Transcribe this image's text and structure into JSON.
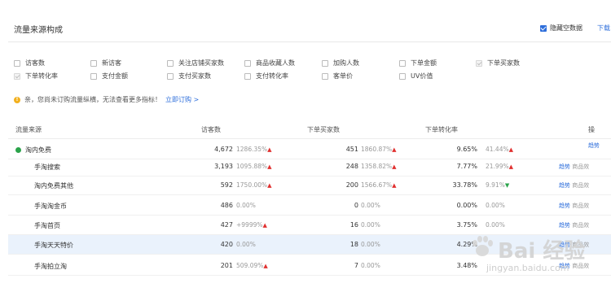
{
  "panel": {
    "title": "流量来源构成",
    "hide_empty_label": "隐藏空数据",
    "download_label": "下载"
  },
  "metrics": [
    {
      "label": "访客数",
      "state": "disabled"
    },
    {
      "label": "新访客",
      "state": "unchecked"
    },
    {
      "label": "关注店铺买家数",
      "state": "unchecked"
    },
    {
      "label": "商品收藏人数",
      "state": "unchecked"
    },
    {
      "label": "加购人数",
      "state": "unchecked"
    },
    {
      "label": "下单金额",
      "state": "unchecked"
    },
    {
      "label": "下单买家数",
      "state": "disabled"
    },
    {
      "label": "下单转化率",
      "state": "disabled"
    },
    {
      "label": "支付金额",
      "state": "unchecked"
    },
    {
      "label": "支付买家数",
      "state": "unchecked"
    },
    {
      "label": "支付转化率",
      "state": "unchecked"
    },
    {
      "label": "客单价",
      "state": "unchecked"
    },
    {
      "label": "UV价值",
      "state": "unchecked"
    }
  ],
  "notice": {
    "text": "亲，您尚未订购流量纵横，无法查看更多指标！",
    "link": "立即订购 >"
  },
  "table": {
    "headers": [
      "流量来源",
      "访客数",
      "下单买家数",
      "下单转化率",
      "操"
    ],
    "rows": [
      {
        "source": "淘内免费",
        "visitors": "4,672",
        "visitors_pct": "1286.35%",
        "visitors_trend": "up",
        "buyers": "451",
        "buyers_pct": "1860.87%",
        "buyers_trend": "up",
        "conv": "9.65%",
        "conv_pct": "41.44%",
        "conv_trend": "up",
        "op1": "趋势",
        "op2": ""
      },
      {
        "source": "手淘搜索",
        "visitors": "3,193",
        "visitors_pct": "1095.88%",
        "visitors_trend": "up",
        "buyers": "248",
        "buyers_pct": "1358.82%",
        "buyers_trend": "up",
        "conv": "7.77%",
        "conv_pct": "21.99%",
        "conv_trend": "up",
        "op1": "趋势",
        "op2": "商品效"
      },
      {
        "source": "淘内免费其他",
        "visitors": "592",
        "visitors_pct": "1750.00%",
        "visitors_trend": "up",
        "buyers": "200",
        "buyers_pct": "1566.67%",
        "buyers_trend": "up",
        "conv": "33.78%",
        "conv_pct": "9.91%",
        "conv_trend": "down",
        "op1": "趋势",
        "op2": "商品效"
      },
      {
        "source": "手淘淘金币",
        "visitors": "486",
        "visitors_pct": "0.00%",
        "visitors_trend": "",
        "buyers": "0",
        "buyers_pct": "0.00%",
        "buyers_trend": "",
        "conv": "0.00%",
        "conv_pct": "0.00%",
        "conv_trend": "",
        "op1": "趋势",
        "op2": "商品效"
      },
      {
        "source": "手淘首页",
        "visitors": "427",
        "visitors_pct": "+9999%",
        "visitors_trend": "up",
        "buyers": "16",
        "buyers_pct": "0.00%",
        "buyers_trend": "",
        "conv": "3.75%",
        "conv_pct": "0.00%",
        "conv_trend": "",
        "op1": "趋势",
        "op2": "商品效"
      },
      {
        "source": "手淘天天特价",
        "visitors": "420",
        "visitors_pct": "0.00%",
        "visitors_trend": "",
        "buyers": "18",
        "buyers_pct": "0.00%",
        "buyers_trend": "",
        "conv": "4.29%",
        "conv_pct": "",
        "conv_trend": "",
        "op1": "趋势",
        "op2": "商品效"
      },
      {
        "source": "手淘拍立淘",
        "visitors": "201",
        "visitors_pct": "509.09%",
        "visitors_trend": "up",
        "buyers": "7",
        "buyers_pct": "0.00%",
        "buyers_trend": "",
        "conv": "3.48%",
        "conv_pct": "",
        "conv_trend": "",
        "op1": "趋势",
        "op2": "商品效"
      }
    ]
  },
  "watermark": {
    "brand": "Bai 经验",
    "url": "jingyan.baidu.com"
  },
  "colors": {
    "accent": "#2f6fdb",
    "up": "#e0302f",
    "down": "#2aa34a",
    "warn": "#f2b01e",
    "highlight_row": "#eaf2fc"
  }
}
